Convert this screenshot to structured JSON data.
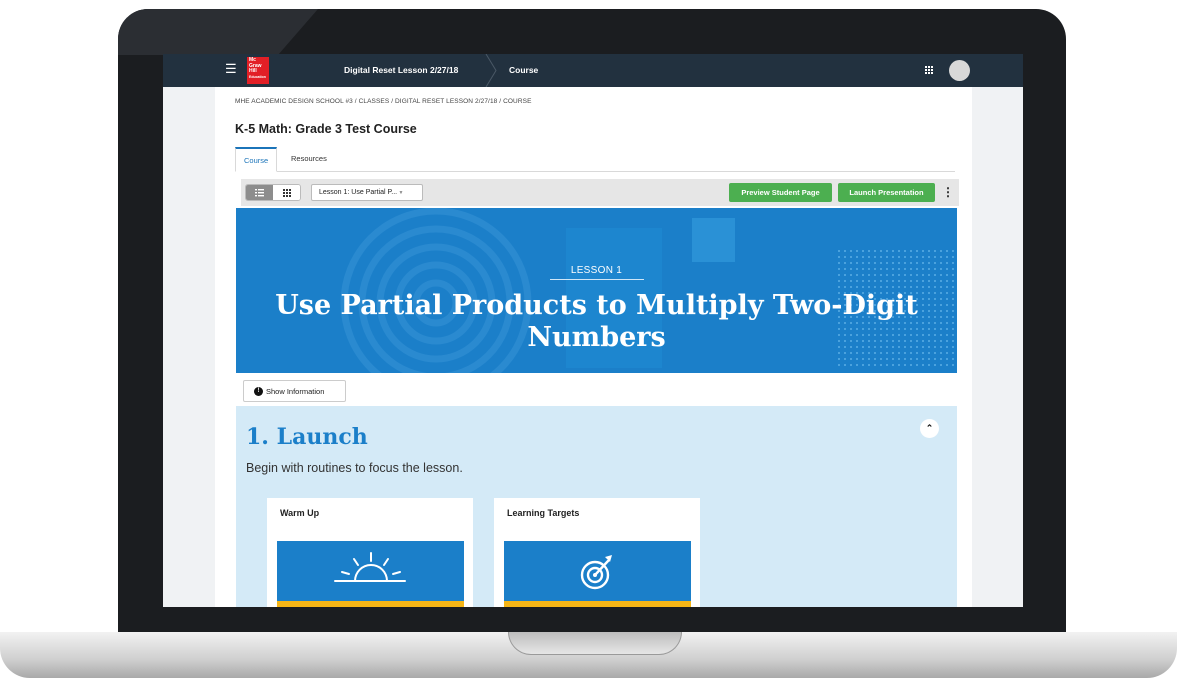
{
  "topbar": {
    "logo_text": [
      "Mc",
      "Graw",
      "Hill",
      "Education"
    ],
    "lesson_crumb": "Digital Reset Lesson 2/27/18",
    "current": "Course"
  },
  "breadcrumb": "MHE ACADEMIC DESIGN SCHOOL #3  /  CLASSES  /  DIGITAL RESET LESSON 2/27/18  /  COURSE",
  "course_title": "K-5 Math: Grade 3 Test Course",
  "tabs": [
    {
      "label": "Course",
      "active": true
    },
    {
      "label": "Resources",
      "active": false
    }
  ],
  "toolbar": {
    "lesson_select": "Lesson 1: Use Partial P...",
    "preview_label": "Preview Student Page",
    "launch_label": "Launch Presentation"
  },
  "banner": {
    "label": "LESSON 1",
    "title": "Use Partial Products to Multiply Two-Digit Numbers"
  },
  "info_button": "Show Information",
  "section": {
    "title": "1. Launch",
    "subtitle": "Begin with routines to focus the lesson."
  },
  "cards": [
    {
      "title": "Warm Up",
      "icon": "sunrise-icon"
    },
    {
      "title": "Learning Targets",
      "icon": "target-icon"
    }
  ],
  "colors": {
    "topbar": "#22313f",
    "accent_blue": "#1b7fc9",
    "green_button": "#4caf50",
    "section_bg": "#d4eaf7",
    "card_bar": "#f5b517",
    "logo_red": "#e21f26"
  }
}
